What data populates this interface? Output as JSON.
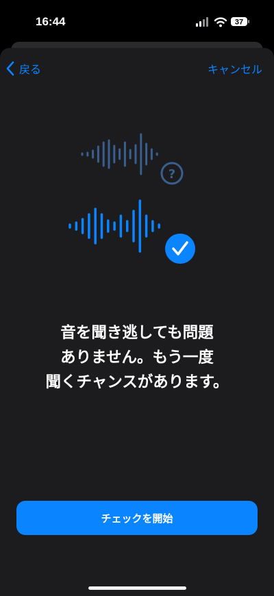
{
  "status_bar": {
    "time": "16:44",
    "battery_level": "37",
    "icons": [
      "signal-icon",
      "wifi-icon",
      "battery-icon"
    ]
  },
  "nav": {
    "back_label": "戻る",
    "cancel_label": "キャンセル"
  },
  "illustration": {
    "icons": [
      "sound-wave-icon",
      "question-mark-icon",
      "checkmark-icon"
    ]
  },
  "message": {
    "lines": [
      "音を聞き逃しても問題",
      "ありません。もう一度",
      "聞くチャンスがあります。"
    ]
  },
  "actions": {
    "start_check": "チェックを開始"
  },
  "colors": {
    "accent": "#0a84ff",
    "faded_accent": "#3a5f8e",
    "sheet_background": "#1c1c1e",
    "page_background": "#000000"
  }
}
